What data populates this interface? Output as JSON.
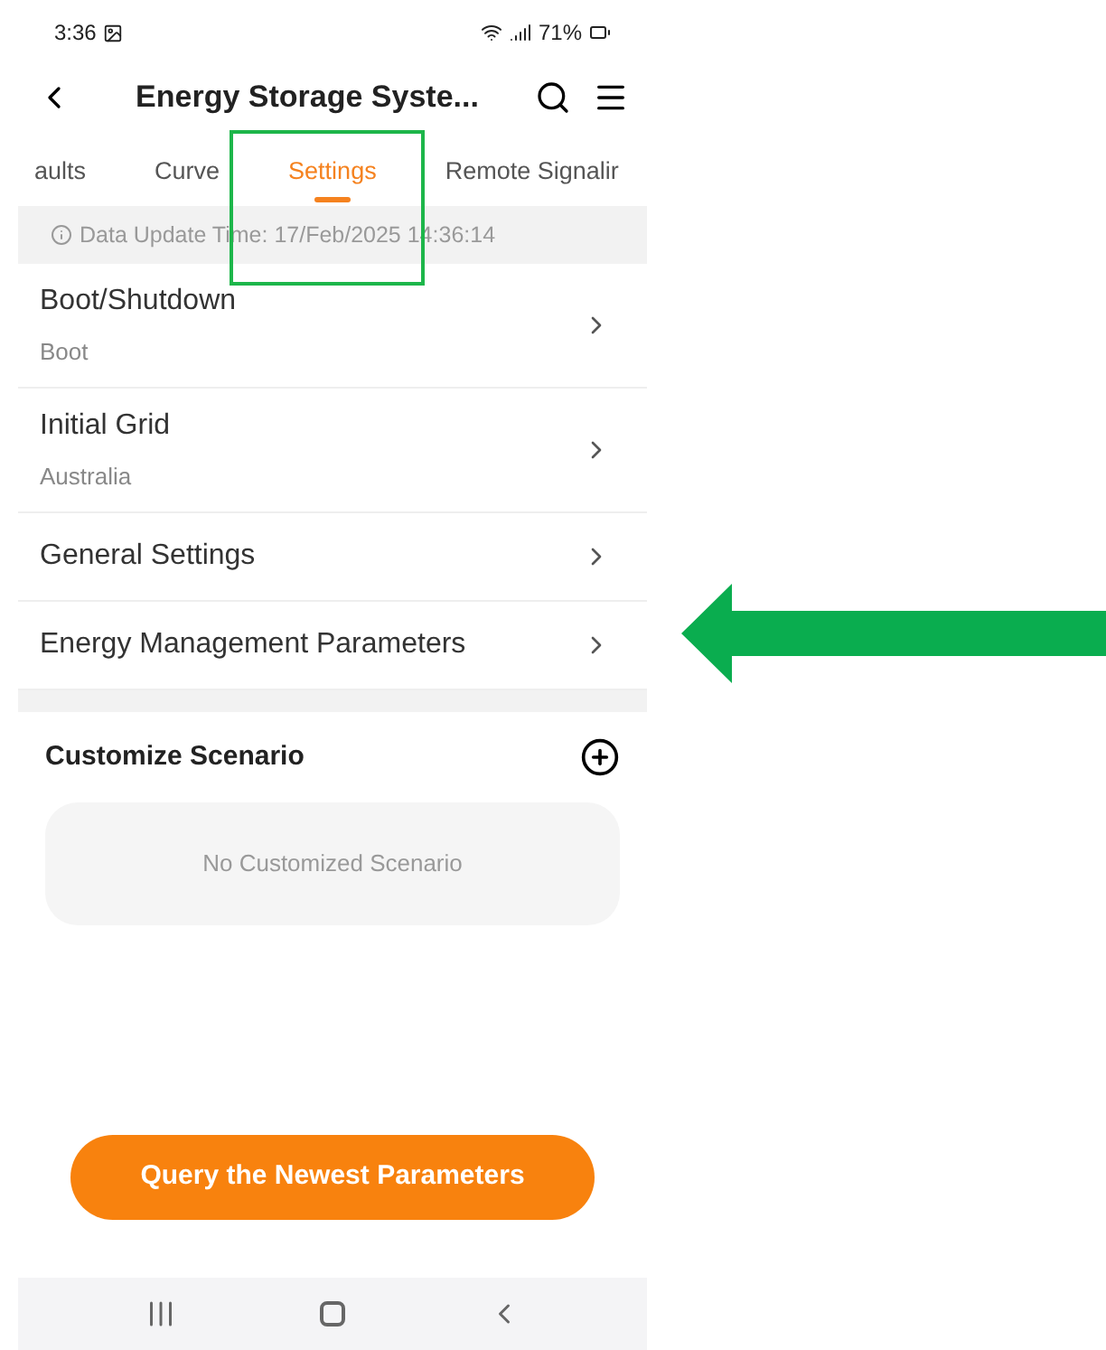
{
  "status_bar": {
    "time": "3:36",
    "battery": "71%"
  },
  "header": {
    "title": "Energy Storage Syste..."
  },
  "tabs": [
    {
      "label": "aults",
      "selected": false
    },
    {
      "label": "Curve",
      "selected": false
    },
    {
      "label": "Settings",
      "selected": true
    },
    {
      "label": "Remote Signalir",
      "selected": false
    }
  ],
  "info_bar": {
    "text": "Data Update Time: 17/Feb/2025 14:36:14"
  },
  "settings": [
    {
      "title": "Boot/Shutdown",
      "value": "Boot"
    },
    {
      "title": "Initial Grid",
      "value": "Australia"
    },
    {
      "title": "General Settings"
    },
    {
      "title": "Energy Management Parameters"
    }
  ],
  "customize_scenario": {
    "title": "Customize Scenario",
    "empty_text": "No Customized Scenario"
  },
  "query_button": "Query the Newest Parameters",
  "annotations": {
    "highlight_box": true,
    "arrow": true
  }
}
